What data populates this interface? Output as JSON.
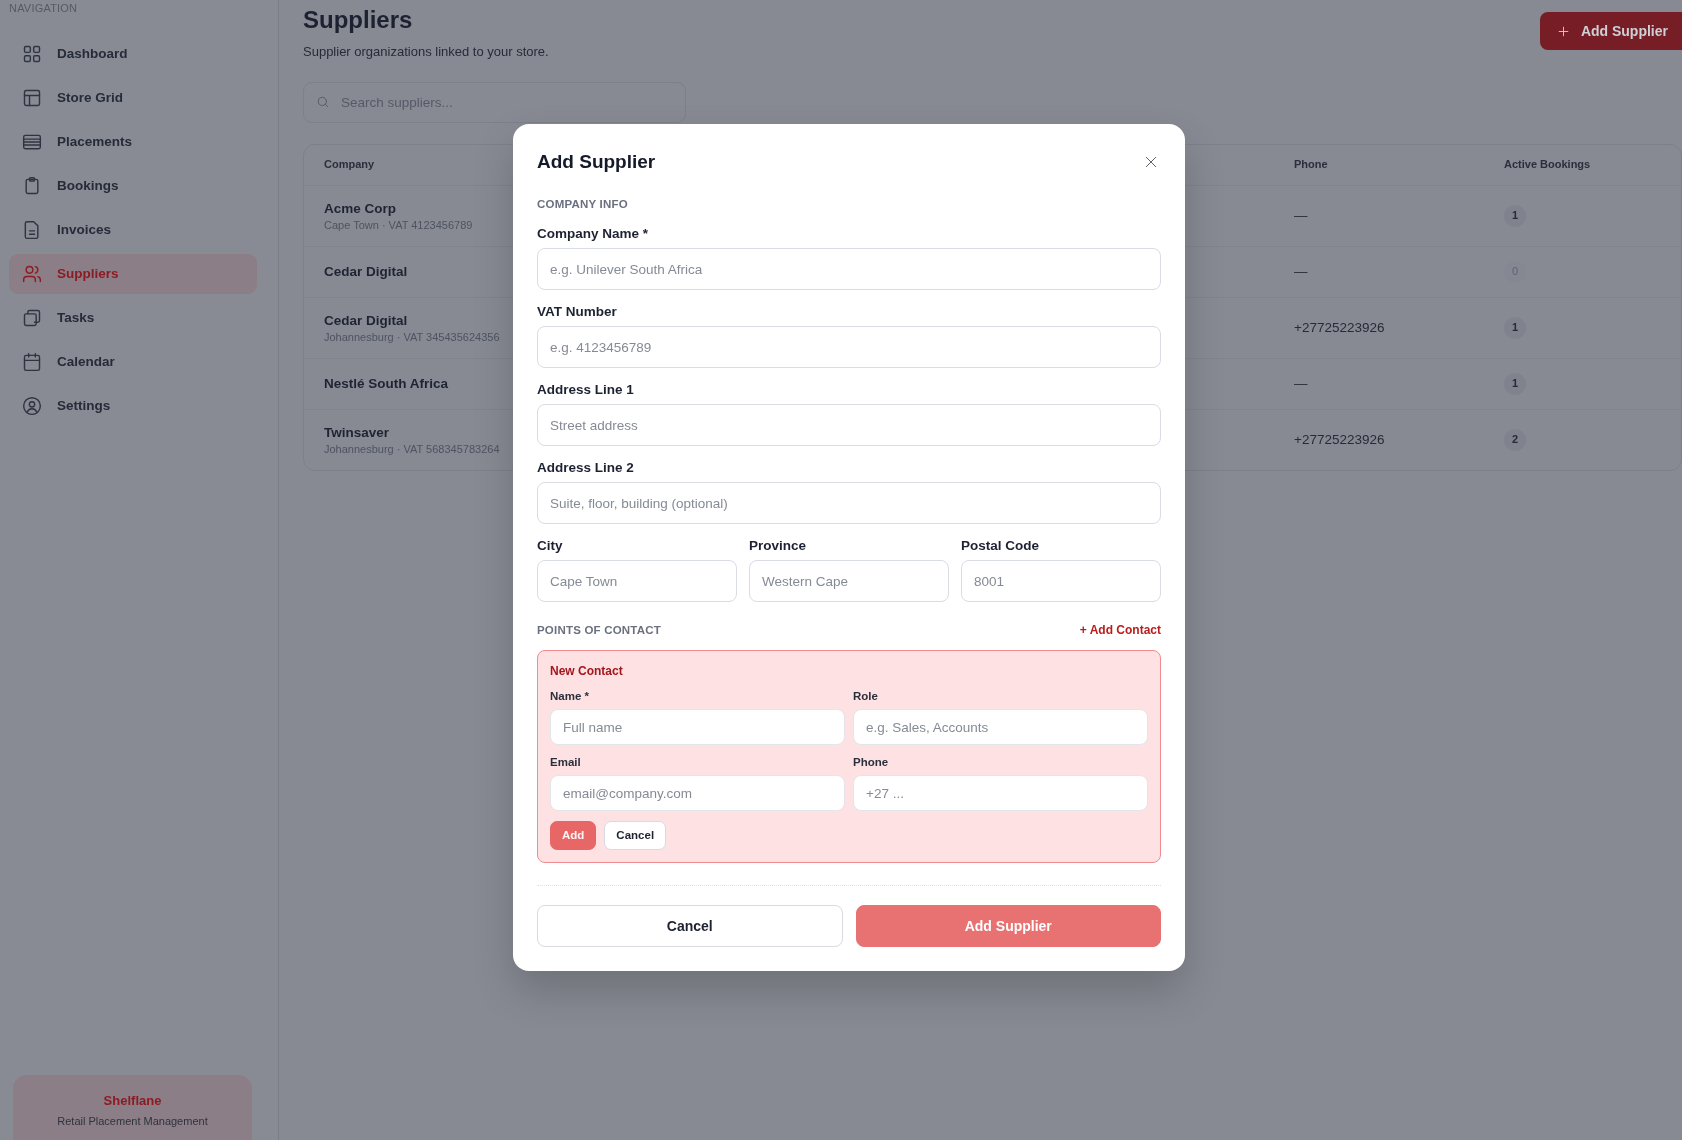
{
  "sidebar": {
    "heading": "NAVIGATION",
    "items": [
      {
        "label": "Dashboard",
        "selected": false
      },
      {
        "label": "Store Grid",
        "selected": false
      },
      {
        "label": "Placements",
        "selected": false
      },
      {
        "label": "Bookings",
        "selected": false
      },
      {
        "label": "Invoices",
        "selected": false
      },
      {
        "label": "Suppliers",
        "selected": true
      },
      {
        "label": "Tasks",
        "selected": false
      },
      {
        "label": "Calendar",
        "selected": false
      },
      {
        "label": "Settings",
        "selected": false
      }
    ],
    "footer": {
      "brand": "Shelflane",
      "tagline": "Retail Placement Management"
    }
  },
  "page": {
    "title": "Suppliers",
    "subtitle": "Supplier organizations linked to your store.",
    "add_button": "Add Supplier",
    "search": {
      "placeholder": "Search suppliers..."
    }
  },
  "table": {
    "columns": [
      "Company",
      "Phone",
      "Active Bookings"
    ],
    "rows": [
      {
        "company": "Acme Corp",
        "details": "Cape Town · VAT 4123456789",
        "phone": "—",
        "active_bookings": "1",
        "dimmed": false
      },
      {
        "company": "Cedar Digital",
        "phone": "—",
        "active_bookings": "0",
        "dimmed": true
      },
      {
        "company": "Cedar Digital",
        "details": "Johannesburg · VAT 345435624356",
        "phone": "+27725223926",
        "active_bookings": "1",
        "dimmed": false
      },
      {
        "company": "Nestlé South Africa",
        "phone": "—",
        "active_bookings": "1",
        "dimmed": false
      },
      {
        "company": "Twinsaver",
        "details": "Johannesburg · VAT 568345783264",
        "phone": "+27725223926",
        "active_bookings": "2",
        "dimmed": false
      }
    ]
  },
  "modal": {
    "title": "Add Supplier",
    "company_info": {
      "heading": "COMPANY INFO",
      "fields": [
        {
          "label": "Company Name *",
          "placeholder": "e.g. Unilever South Africa"
        },
        {
          "label": "VAT Number",
          "placeholder": "e.g. 4123456789"
        },
        {
          "label": "Address Line 1",
          "placeholder": "Street address"
        },
        {
          "label": "Address Line 2",
          "placeholder": "Suite, floor, building (optional)"
        }
      ],
      "location_fields": [
        {
          "label": "City",
          "placeholder": "Cape Town"
        },
        {
          "label": "Province",
          "placeholder": "Western Cape"
        },
        {
          "label": "Postal Code",
          "placeholder": "8001"
        }
      ]
    },
    "contacts": {
      "heading": "POINTS OF CONTACT",
      "add_link": "+ Add Contact",
      "new_contact": {
        "title": "New Contact",
        "fields": [
          {
            "label": "Name *",
            "placeholder": "Full name"
          },
          {
            "label": "Role",
            "placeholder": "e.g. Sales, Accounts"
          },
          {
            "label": "Email",
            "placeholder": "email@company.com"
          },
          {
            "label": "Phone",
            "placeholder": "+27 ..."
          }
        ],
        "buttons": [
          {
            "label": "Add",
            "kind": "primary",
            "disabled": true
          },
          {
            "label": "Cancel",
            "kind": "secondary",
            "disabled": false
          }
        ]
      }
    },
    "buttons": [
      {
        "label": "Cancel",
        "kind": "secondary",
        "disabled": false
      },
      {
        "label": "Add Supplier",
        "kind": "primary",
        "disabled": true
      }
    ]
  }
}
